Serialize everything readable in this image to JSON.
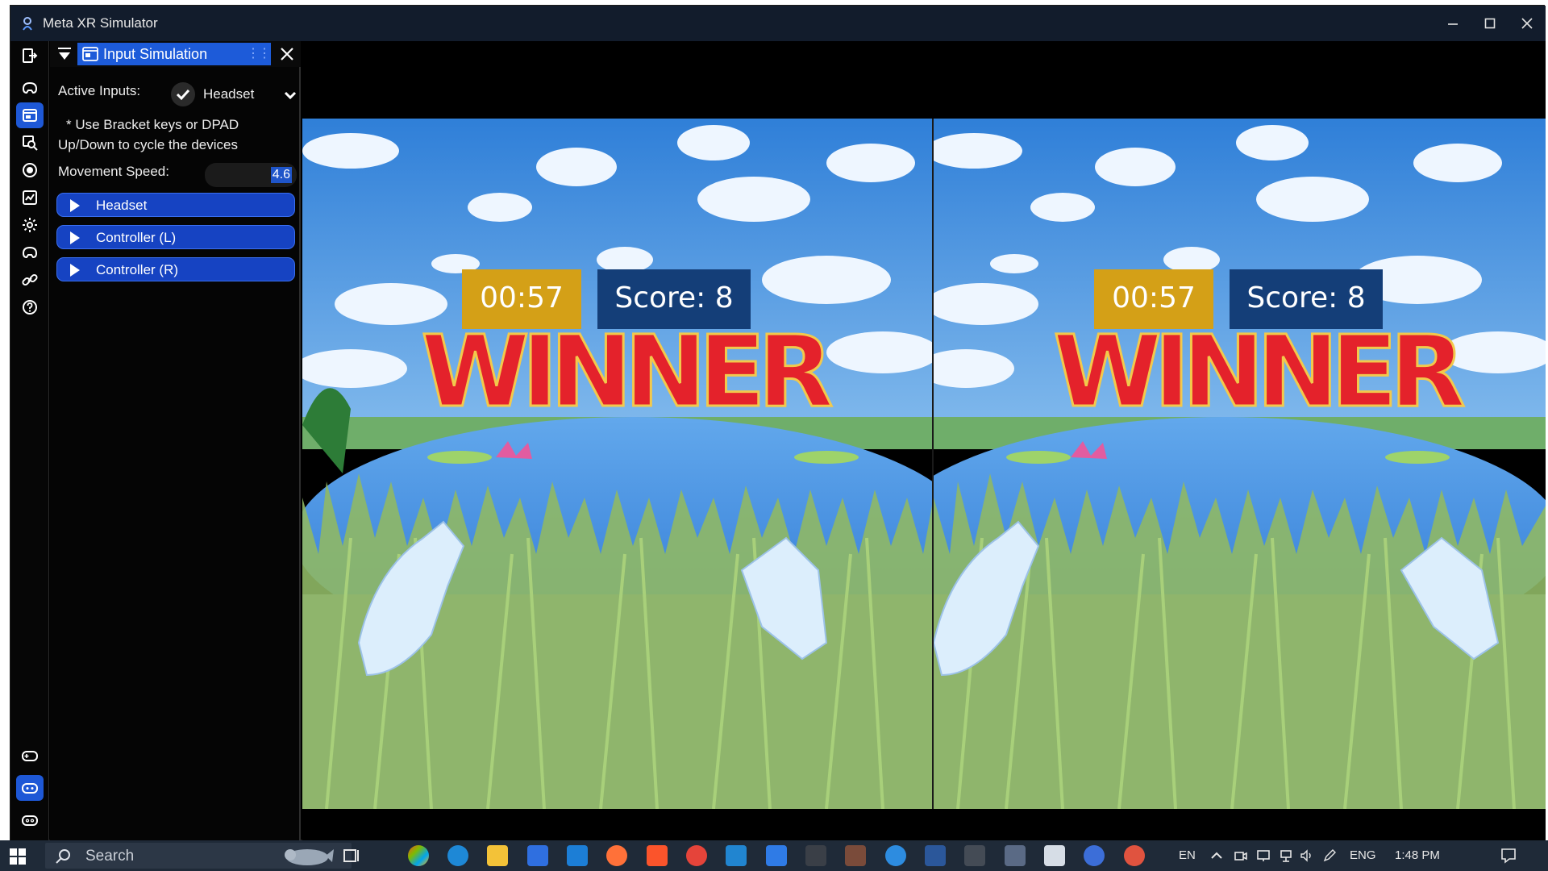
{
  "window": {
    "title": "Meta XR Simulator"
  },
  "panel": {
    "tab_label": "Input Simulation",
    "active_inputs_label": "Active Inputs:",
    "active_input_value": "Headset",
    "hint_line1": "* Use Bracket keys or DPAD",
    "hint_line2": "Up/Down to cycle the devices",
    "movement_speed_label": "Movement Speed:",
    "movement_speed_value": "4.6",
    "devices": [
      {
        "label": "Headset"
      },
      {
        "label": "Controller (L)"
      },
      {
        "label": "Controller (R)"
      }
    ]
  },
  "scene": {
    "timer": "00:57",
    "score": "Score: 8",
    "banner": "WINNER",
    "colors": {
      "sky": "#3f8fe0",
      "timer_bg": "#d4a017",
      "score_bg": "#143e78",
      "banner_fill": "#e4222b",
      "banner_outline": "#f2c94c",
      "grass": "#8fb865",
      "water": "#3b8fe0"
    }
  },
  "taskbar": {
    "search_placeholder": "Search",
    "language_short": "EN",
    "language": "ENG",
    "time": "1:48 PM"
  },
  "colors": {
    "accent": "#1d5bd9",
    "titlebar": "#121c2c",
    "taskbar": "#1f2a38"
  }
}
